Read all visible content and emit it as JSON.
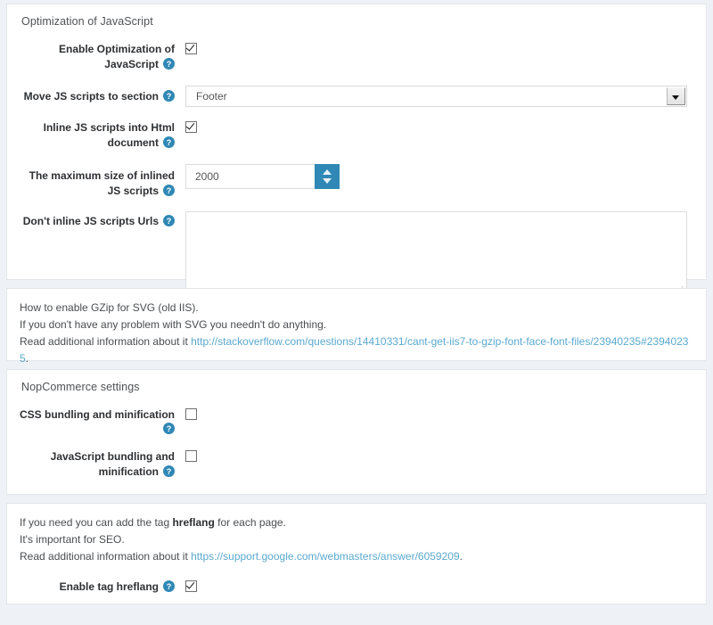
{
  "colors": {
    "accent": "#2f88b5",
    "link": "#5aa9cf",
    "panel_bg": "#ffffff",
    "page_bg": "#eef1f5",
    "label": "#2e3033"
  },
  "panels": {
    "js_optimization": {
      "title": "Optimization of JavaScript",
      "rows": [
        {
          "label": "Enable Optimization of JavaScript",
          "help_icon": "question-circle-icon",
          "control": "checkbox",
          "checked": true
        },
        {
          "label": "Move JS scripts to section",
          "help_icon": "question-circle-icon",
          "control": "select",
          "value": "Footer",
          "options": [
            "Footer"
          ],
          "dropdown_icon": "caret-down-icon"
        },
        {
          "label": "Inline JS scripts into Html document",
          "help_icon": "question-circle-icon",
          "control": "checkbox",
          "checked": true
        },
        {
          "label": "The maximum size of inlined JS scripts",
          "help_icon": "question-circle-icon",
          "control": "number",
          "value": "2000",
          "spinner_up_icon": "caret-up-icon",
          "spinner_down_icon": "caret-down-icon"
        },
        {
          "label": "Don't inline JS scripts Urls",
          "help_icon": "question-circle-icon",
          "control": "textarea",
          "value": "",
          "placeholder": "",
          "resize_handle_icon": "resize-grip-icon"
        }
      ]
    },
    "gzip_info": {
      "lines": [
        "How to enable GZip for SVG (old IIS).",
        "If you don't have any problem with SVG you needn't do anything."
      ],
      "read_more_prefix": "Read additional information about it ",
      "read_more_link": "http://stackoverflow.com/questions/14410331/cant-get-iis7-to-gzip-font-face-font-files/23940235#23940235",
      "read_more_suffix": "."
    },
    "nopcommerce": {
      "title": "NopCommerce settings",
      "rows": [
        {
          "label": "CSS bundling and minification",
          "help_icon": "question-circle-icon",
          "control": "checkbox",
          "checked": false
        },
        {
          "label": "JavaScript bundling and minification",
          "help_icon": "question-circle-icon",
          "control": "checkbox",
          "checked": false
        }
      ]
    },
    "hreflang": {
      "line1_prefix": "If you need you can add the tag ",
      "line1_bold": "hreflang",
      "line1_suffix": " for each page.",
      "line2": "It's important for SEO.",
      "read_more_prefix": "Read additional information about it ",
      "read_more_link": "https://support.google.com/webmasters/answer/6059209",
      "read_more_suffix": ".",
      "row": {
        "label": "Enable tag hreflang",
        "help_icon": "question-circle-icon",
        "control": "checkbox",
        "checked": true
      }
    }
  }
}
